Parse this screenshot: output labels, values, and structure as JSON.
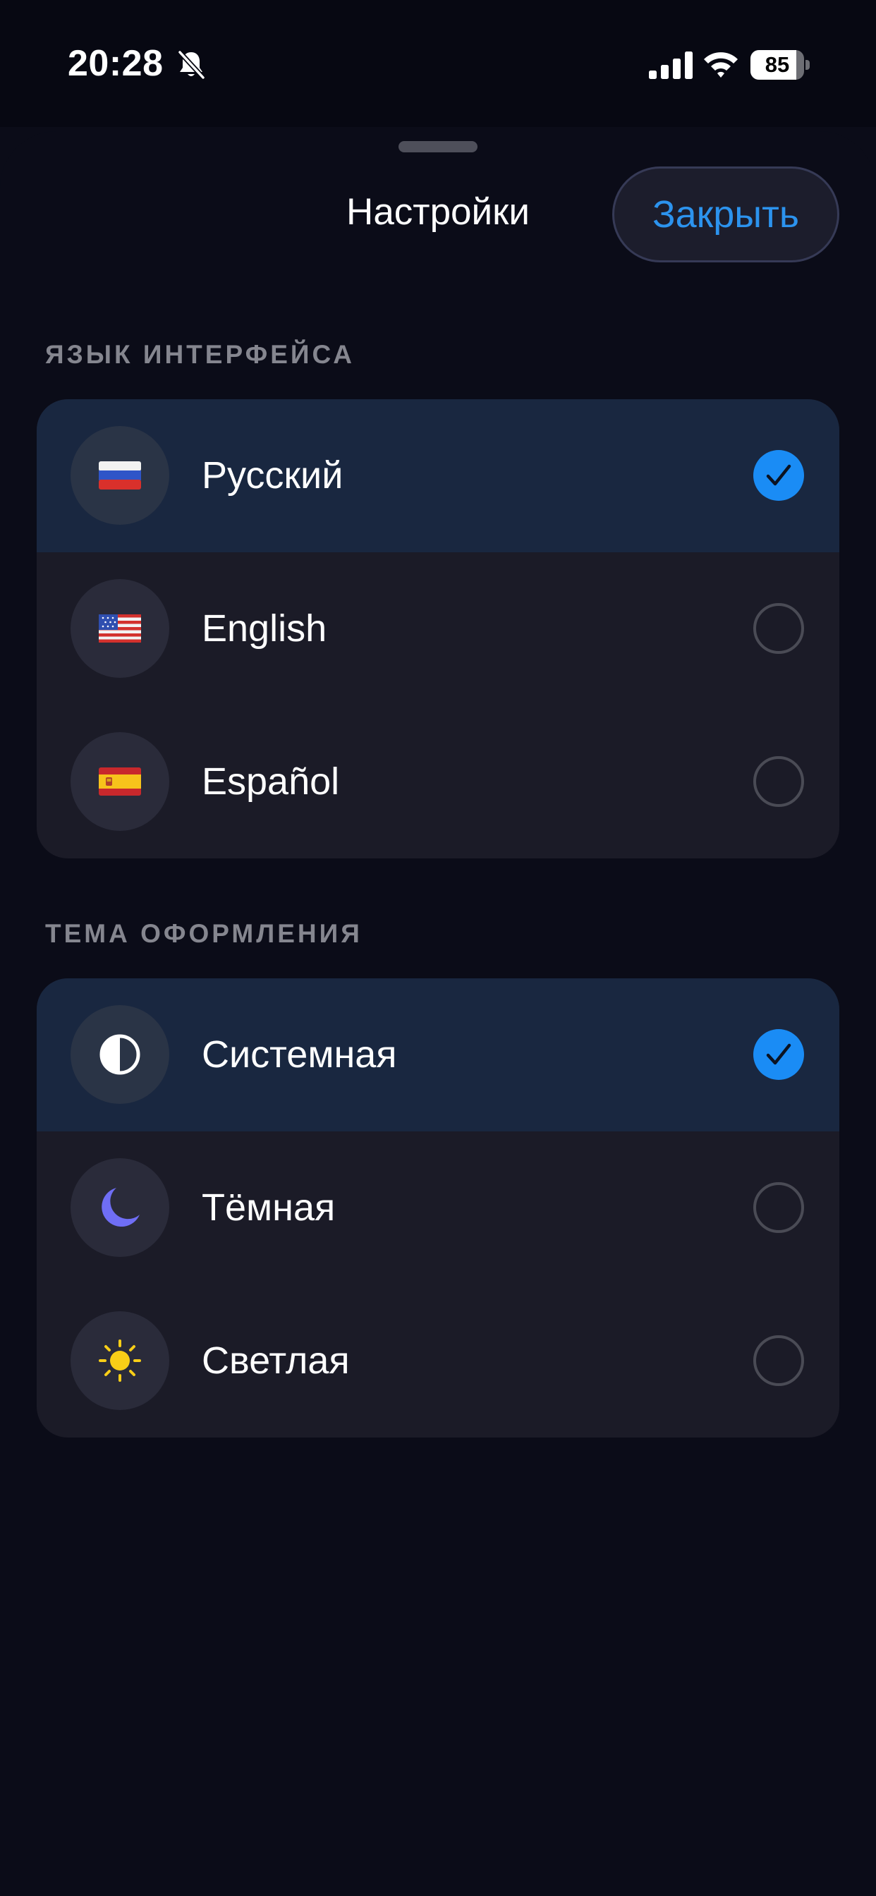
{
  "status_bar": {
    "time": "20:28",
    "battery_percent": "85",
    "battery_level": 0.85
  },
  "sheet": {
    "title": "Настройки",
    "close_label": "Закрыть"
  },
  "language_section": {
    "header": "ЯЗЫК ИНТЕРФЕЙСА",
    "items": [
      {
        "icon": "flag-russia-icon",
        "label": "Русский",
        "selected": true
      },
      {
        "icon": "flag-usa-icon",
        "label": "English",
        "selected": false
      },
      {
        "icon": "flag-spain-icon",
        "label": "Español",
        "selected": false
      }
    ]
  },
  "theme_section": {
    "header": "ТЕМА ОФОРМЛЕНИЯ",
    "items": [
      {
        "icon": "half-circle-icon",
        "label": "Системная",
        "selected": true
      },
      {
        "icon": "moon-icon",
        "label": "Тёмная",
        "selected": false
      },
      {
        "icon": "sun-icon",
        "label": "Светлая",
        "selected": false
      }
    ]
  },
  "colors": {
    "accent": "#1a8cf5",
    "close_text": "#2c93ee",
    "selected_row": "#192740",
    "moon": "#6f6ef5",
    "sun": "#f8ce17"
  }
}
